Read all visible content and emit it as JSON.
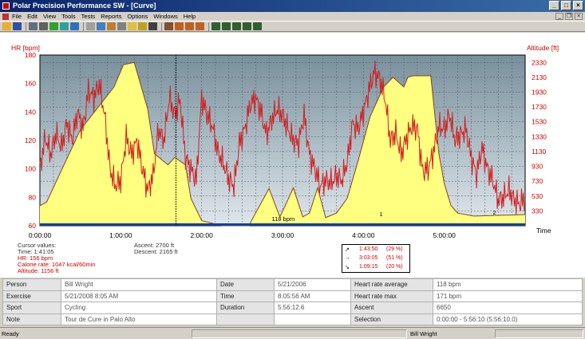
{
  "window": {
    "title": "Polar Precision Performance SW - [Curve]",
    "minimize": "_",
    "maximize": "□",
    "close": "×"
  },
  "menu": [
    "File",
    "Edit",
    "View",
    "Tools",
    "Tests",
    "Reports",
    "Options",
    "Windows",
    "Help"
  ],
  "mdi": {
    "minimize": "_",
    "restore": "❐",
    "close": "×"
  },
  "toolbar_icons": [
    "open-icon",
    "save-icon",
    "print-preview-icon",
    "print-icon",
    "globe-icon",
    "sync-icon",
    "info-icon",
    "copy-icon",
    "window-icon",
    "export-icon",
    "edit-icon",
    "chart-icon",
    "chart-icon",
    "table-icon",
    "zoom-icon",
    "tool-icon",
    "tool-icon",
    "tool-icon",
    "bar-chart-icon",
    "bar-chart-icon",
    "bar-chart-icon",
    "bar-chart-icon",
    "bar-chart-icon"
  ],
  "chart_data": {
    "type": "area",
    "left_axis": {
      "label": "HR [bpm]",
      "ticks": [
        "180",
        "160",
        "140",
        "120",
        "100",
        "80",
        "60"
      ],
      "range": [
        60,
        180
      ]
    },
    "right_axis": {
      "label": "Altitude [ft]",
      "ticks": [
        "2330",
        "2130",
        "1930",
        "1730",
        "1530",
        "1330",
        "1130",
        "930",
        "730",
        "530",
        "330"
      ],
      "range": [
        130,
        2430
      ]
    },
    "x_axis": {
      "label": "Time",
      "ticks": [
        "0:00:00",
        "1:00:00",
        "2:00:00",
        "3:00:00",
        "4:00:00",
        "5:00:00"
      ],
      "range_minutes": [
        0,
        360
      ]
    },
    "grid": true,
    "cursor_time_minutes": 101,
    "annotation": "118 bpm",
    "markers": [
      "1",
      "2"
    ],
    "series": [
      {
        "name": "Altitude",
        "unit": "ft",
        "color": "#ffff80",
        "x_minutes": [
          0,
          5,
          30,
          55,
          62,
          70,
          80,
          85,
          95,
          100,
          108,
          112,
          120,
          135,
          155,
          160,
          170,
          178,
          182,
          188,
          195,
          200,
          206,
          212,
          220,
          228,
          236,
          245,
          255,
          262,
          270,
          273,
          277,
          290,
          296,
          300,
          305,
          310,
          322,
          360
        ],
        "values": [
          400,
          450,
          1420,
          2000,
          2300,
          2330,
          1700,
          1100,
          950,
          1050,
          950,
          500,
          200,
          130,
          130,
          300,
          630,
          250,
          400,
          640,
          250,
          300,
          640,
          240,
          300,
          500,
          1000,
          1600,
          2000,
          2130,
          2000,
          2130,
          2150,
          2150,
          1100,
          700,
          400,
          300,
          260,
          280
        ]
      },
      {
        "name": "HR",
        "unit": "bpm",
        "color": "#d02020",
        "x_minutes": [
          0,
          4,
          8,
          12,
          16,
          20,
          24,
          28,
          32,
          36,
          40,
          44,
          48,
          52,
          56,
          60,
          64,
          68,
          72,
          76,
          80,
          84,
          88,
          92,
          96,
          100,
          104,
          108,
          112,
          116,
          120,
          124,
          128,
          132,
          136,
          140,
          144,
          148,
          152,
          156,
          160,
          164,
          168,
          172,
          176,
          180,
          184,
          188,
          192,
          196,
          200,
          204,
          208,
          212,
          216,
          220,
          224,
          228,
          232,
          236,
          240,
          244,
          248,
          252,
          256,
          260,
          264,
          268,
          272,
          276,
          280,
          284,
          288,
          292,
          296,
          300,
          304,
          308,
          312,
          316,
          320,
          324,
          328,
          332,
          336,
          340,
          344,
          348,
          352,
          356,
          360
        ],
        "values": [
          100,
          122,
          110,
          125,
          115,
          132,
          120,
          140,
          128,
          155,
          150,
          160,
          138,
          100,
          88,
          92,
          122,
          110,
          120,
          100,
          85,
          95,
          128,
          120,
          150,
          138,
          148,
          108,
          100,
          92,
          150,
          138,
          130,
          112,
          104,
          93,
          88,
          118,
          128,
          145,
          150,
          140,
          124,
          135,
          142,
          138,
          128,
          120,
          118,
          138,
          110,
          100,
          88,
          92,
          90,
          95,
          92,
          105,
          132,
          128,
          140,
          155,
          168,
          164,
          150,
          120,
          125,
          110,
          122,
          130,
          128,
          98,
          100,
          112,
          130,
          128,
          138,
          120,
          124,
          128,
          108,
          96,
          115,
          100,
          92,
          78,
          80,
          85,
          78,
          75,
          80
        ]
      }
    ]
  },
  "cursor_values": {
    "header": "Cursor values:",
    "time": "Time: 1:41:05",
    "hr": "HR: 156 bpm",
    "calorie": "Calorie rate: 1047 kcal/60min",
    "altitude": "Altitude: 1156 ft",
    "ascent": "Ascent: 2700 ft",
    "descent": "Descent: 2165 ft"
  },
  "zones": [
    {
      "icon": "↗",
      "time": "1:43:50",
      "pct": "(29 %)"
    },
    {
      "icon": "→",
      "time": "3:03:05",
      "pct": "(51 %)"
    },
    {
      "icon": "↘",
      "time": "1:09:15",
      "pct": "(20 %)"
    }
  ],
  "info": {
    "rows": [
      [
        "Person",
        "Bill Wright",
        "Date",
        "5/21/2006",
        "Heart rate average",
        "118 bpm"
      ],
      [
        "Exercise",
        "5/21/2008 8:05 AM",
        "Time",
        "8:05:56 AM",
        "Heart rate max",
        "171 bpm"
      ],
      [
        "Sport",
        "Cycling",
        "Duration",
        "5:56:12.6",
        "Ascent",
        "6650"
      ],
      [
        "Note",
        "Tour de Cure in Palo Alto",
        "",
        "",
        "Selection",
        "0:00:00 - 5:56:10 (5:56:10.0)"
      ]
    ]
  },
  "status": {
    "left": "Ready",
    "user": "Bill Wright"
  },
  "colors": {
    "hr": "#d02020",
    "altitude_fill": "#ffff80",
    "altitude_line": "#8b4513",
    "plot_bg_top": "#78909c",
    "plot_bg_bottom": "#dfe7ec"
  }
}
